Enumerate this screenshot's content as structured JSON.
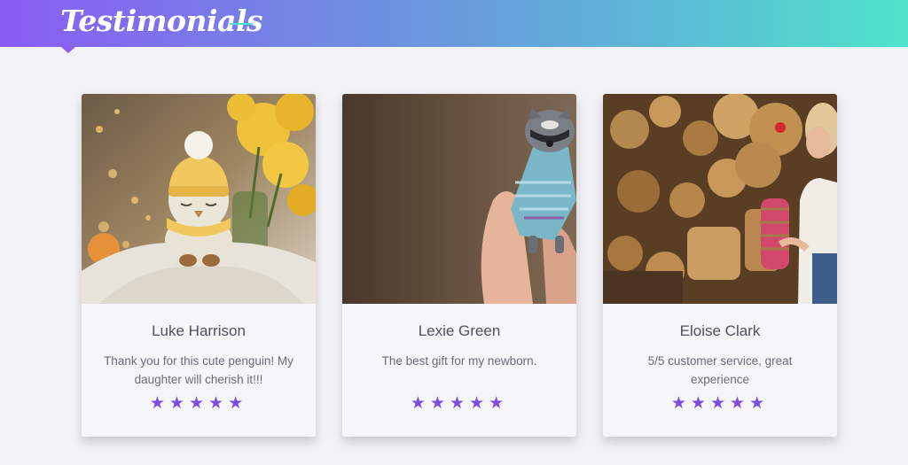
{
  "header": {
    "title": "Testimonials",
    "gradient_start": "#8a5cf5",
    "gradient_end": "#4fe3c9"
  },
  "testimonials": [
    {
      "photo_icon": "crochet-penguin-photo",
      "name": "Luke Harrison",
      "text": "Thank you for this cute penguin! My daughter will cherish it!!!",
      "rating": 5
    },
    {
      "photo_icon": "crochet-raccoon-photo",
      "name": "Lexie Green",
      "text": "The best gift for my newborn.",
      "rating": 5
    },
    {
      "photo_icon": "straw-bags-market-photo",
      "name": "Eloise Clark",
      "text": "5/5 customer service, great experience",
      "rating": 5
    }
  ],
  "star_color": "#7a4fe0"
}
